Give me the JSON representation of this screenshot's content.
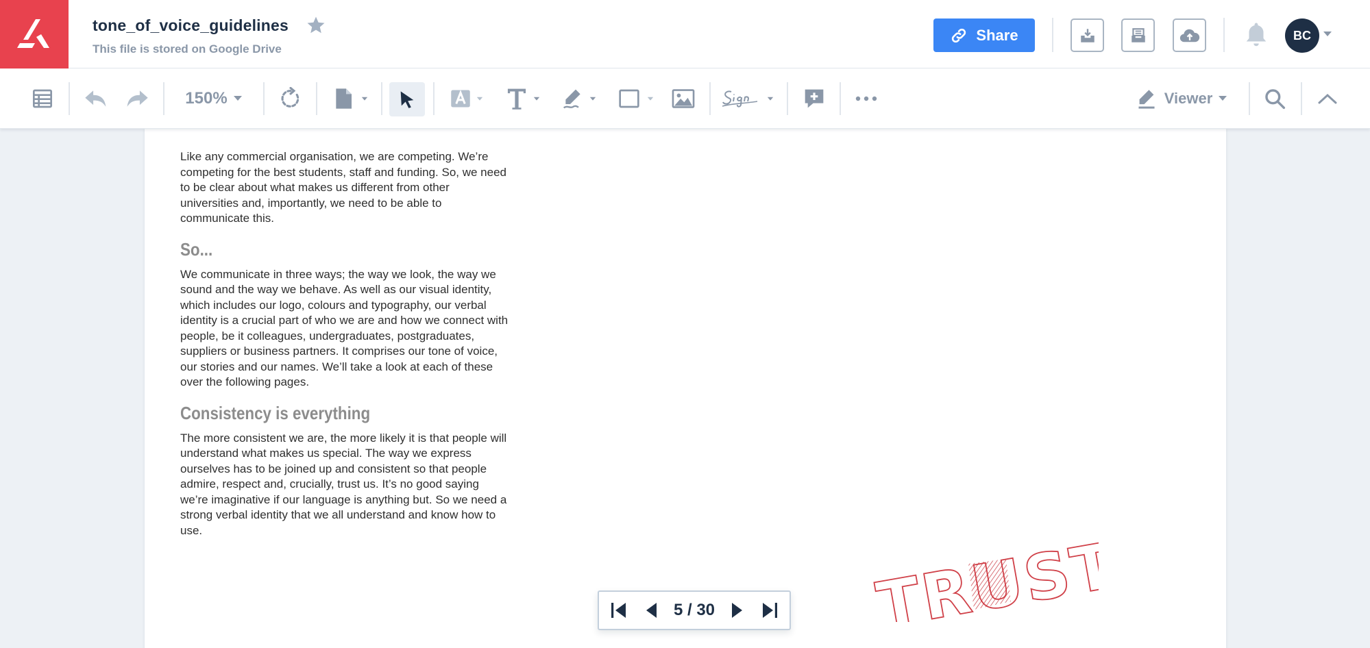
{
  "app": {
    "file_title": "tone_of_voice_guidelines",
    "file_subtitle": "This file is stored on Google Drive",
    "share_label": "Share",
    "avatar_initials": "BC",
    "brand_color": "#e8424e",
    "accent_color": "#3b86f5"
  },
  "toolbar": {
    "zoom_label": "150%",
    "mode_label": "Viewer",
    "icons": [
      "sidebar-icon",
      "undo-icon",
      "redo-icon",
      "zoom-select",
      "rotate-icon",
      "page-icon",
      "select-arrow-icon",
      "text-highlight-icon",
      "text-icon",
      "pen-icon",
      "shape-icon",
      "image-icon",
      "signature-icon",
      "add-comment-icon",
      "more-icon",
      "pencil-icon",
      "search-icon",
      "collapse-icon"
    ]
  },
  "document": {
    "paragraphs": [
      "Like any commercial organisation, we are competing. We’re competing for the best students, staff and funding. So, we need to be clear about what makes us different from other universities and, importantly, we need to be able to communicate this.",
      "We communicate in three ways; the way we look, the way we sound and the way we behave. As well as our visual identity, which includes our logo, colours and typography, our verbal identity is a crucial part of who we are and how we connect with people, be it colleagues, undergraduates, postgraduates, suppliers or business partners. It comprises our tone of voice, our stories and our names. We’ll take a look at each of these over the following pages.",
      "The more consistent we are, the more likely it is that people will understand what makes us special. The way we express ourselves has to be joined up and consistent so that people admire, respect and, crucially, trust us. It’s no good saying we’re imaginative if our language is anything but. So we need a strong verbal identity that we all understand and know how to use."
    ],
    "headings": [
      "So...",
      "Consistency is everything"
    ],
    "illustration_word": "TRUST"
  },
  "pager": {
    "current": "5",
    "total": "30",
    "label": "5 / 30"
  }
}
